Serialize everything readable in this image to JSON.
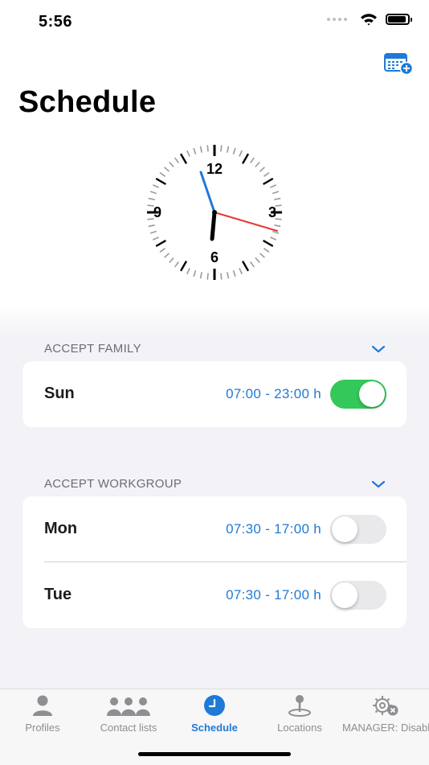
{
  "status_bar": {
    "time": "5:56"
  },
  "header": {
    "title": "Schedule",
    "add_icon": "calendar-plus-icon"
  },
  "clock": {
    "numerals": [
      "12",
      "3",
      "6",
      "9"
    ],
    "hour_hand_color": "#000000",
    "minute_hand_color": "#1f7ad6",
    "second_hand_color": "#e53935",
    "time_shown": "5:56"
  },
  "sections": [
    {
      "header": "ACCEPT FAMILY",
      "rows": [
        {
          "day": "Sun",
          "hours": "07:00 - 23:00 h",
          "enabled": true
        }
      ]
    },
    {
      "header": "ACCEPT WORKGROUP",
      "rows": [
        {
          "day": "Mon",
          "hours": "07:30 - 17:00 h",
          "enabled": false
        },
        {
          "day": "Tue",
          "hours": "07:30 - 17:00 h",
          "enabled": false
        }
      ]
    }
  ],
  "tab_bar": {
    "items": [
      {
        "label": "Profiles",
        "icon": "person-icon"
      },
      {
        "label": "Contact lists",
        "icon": "people-group-icon"
      },
      {
        "label": "Schedule",
        "icon": "clock-icon",
        "active": true
      },
      {
        "label": "Locations",
        "icon": "map-pin-icon"
      },
      {
        "label": "MANAGER: Disabled",
        "icon": "gear-disabled-icon"
      }
    ]
  },
  "colors": {
    "accent": "#1f7ad6",
    "toggle_on": "#34c759",
    "toggle_off": "#e9e9eb",
    "grouped_background": "#f2f2f7"
  }
}
